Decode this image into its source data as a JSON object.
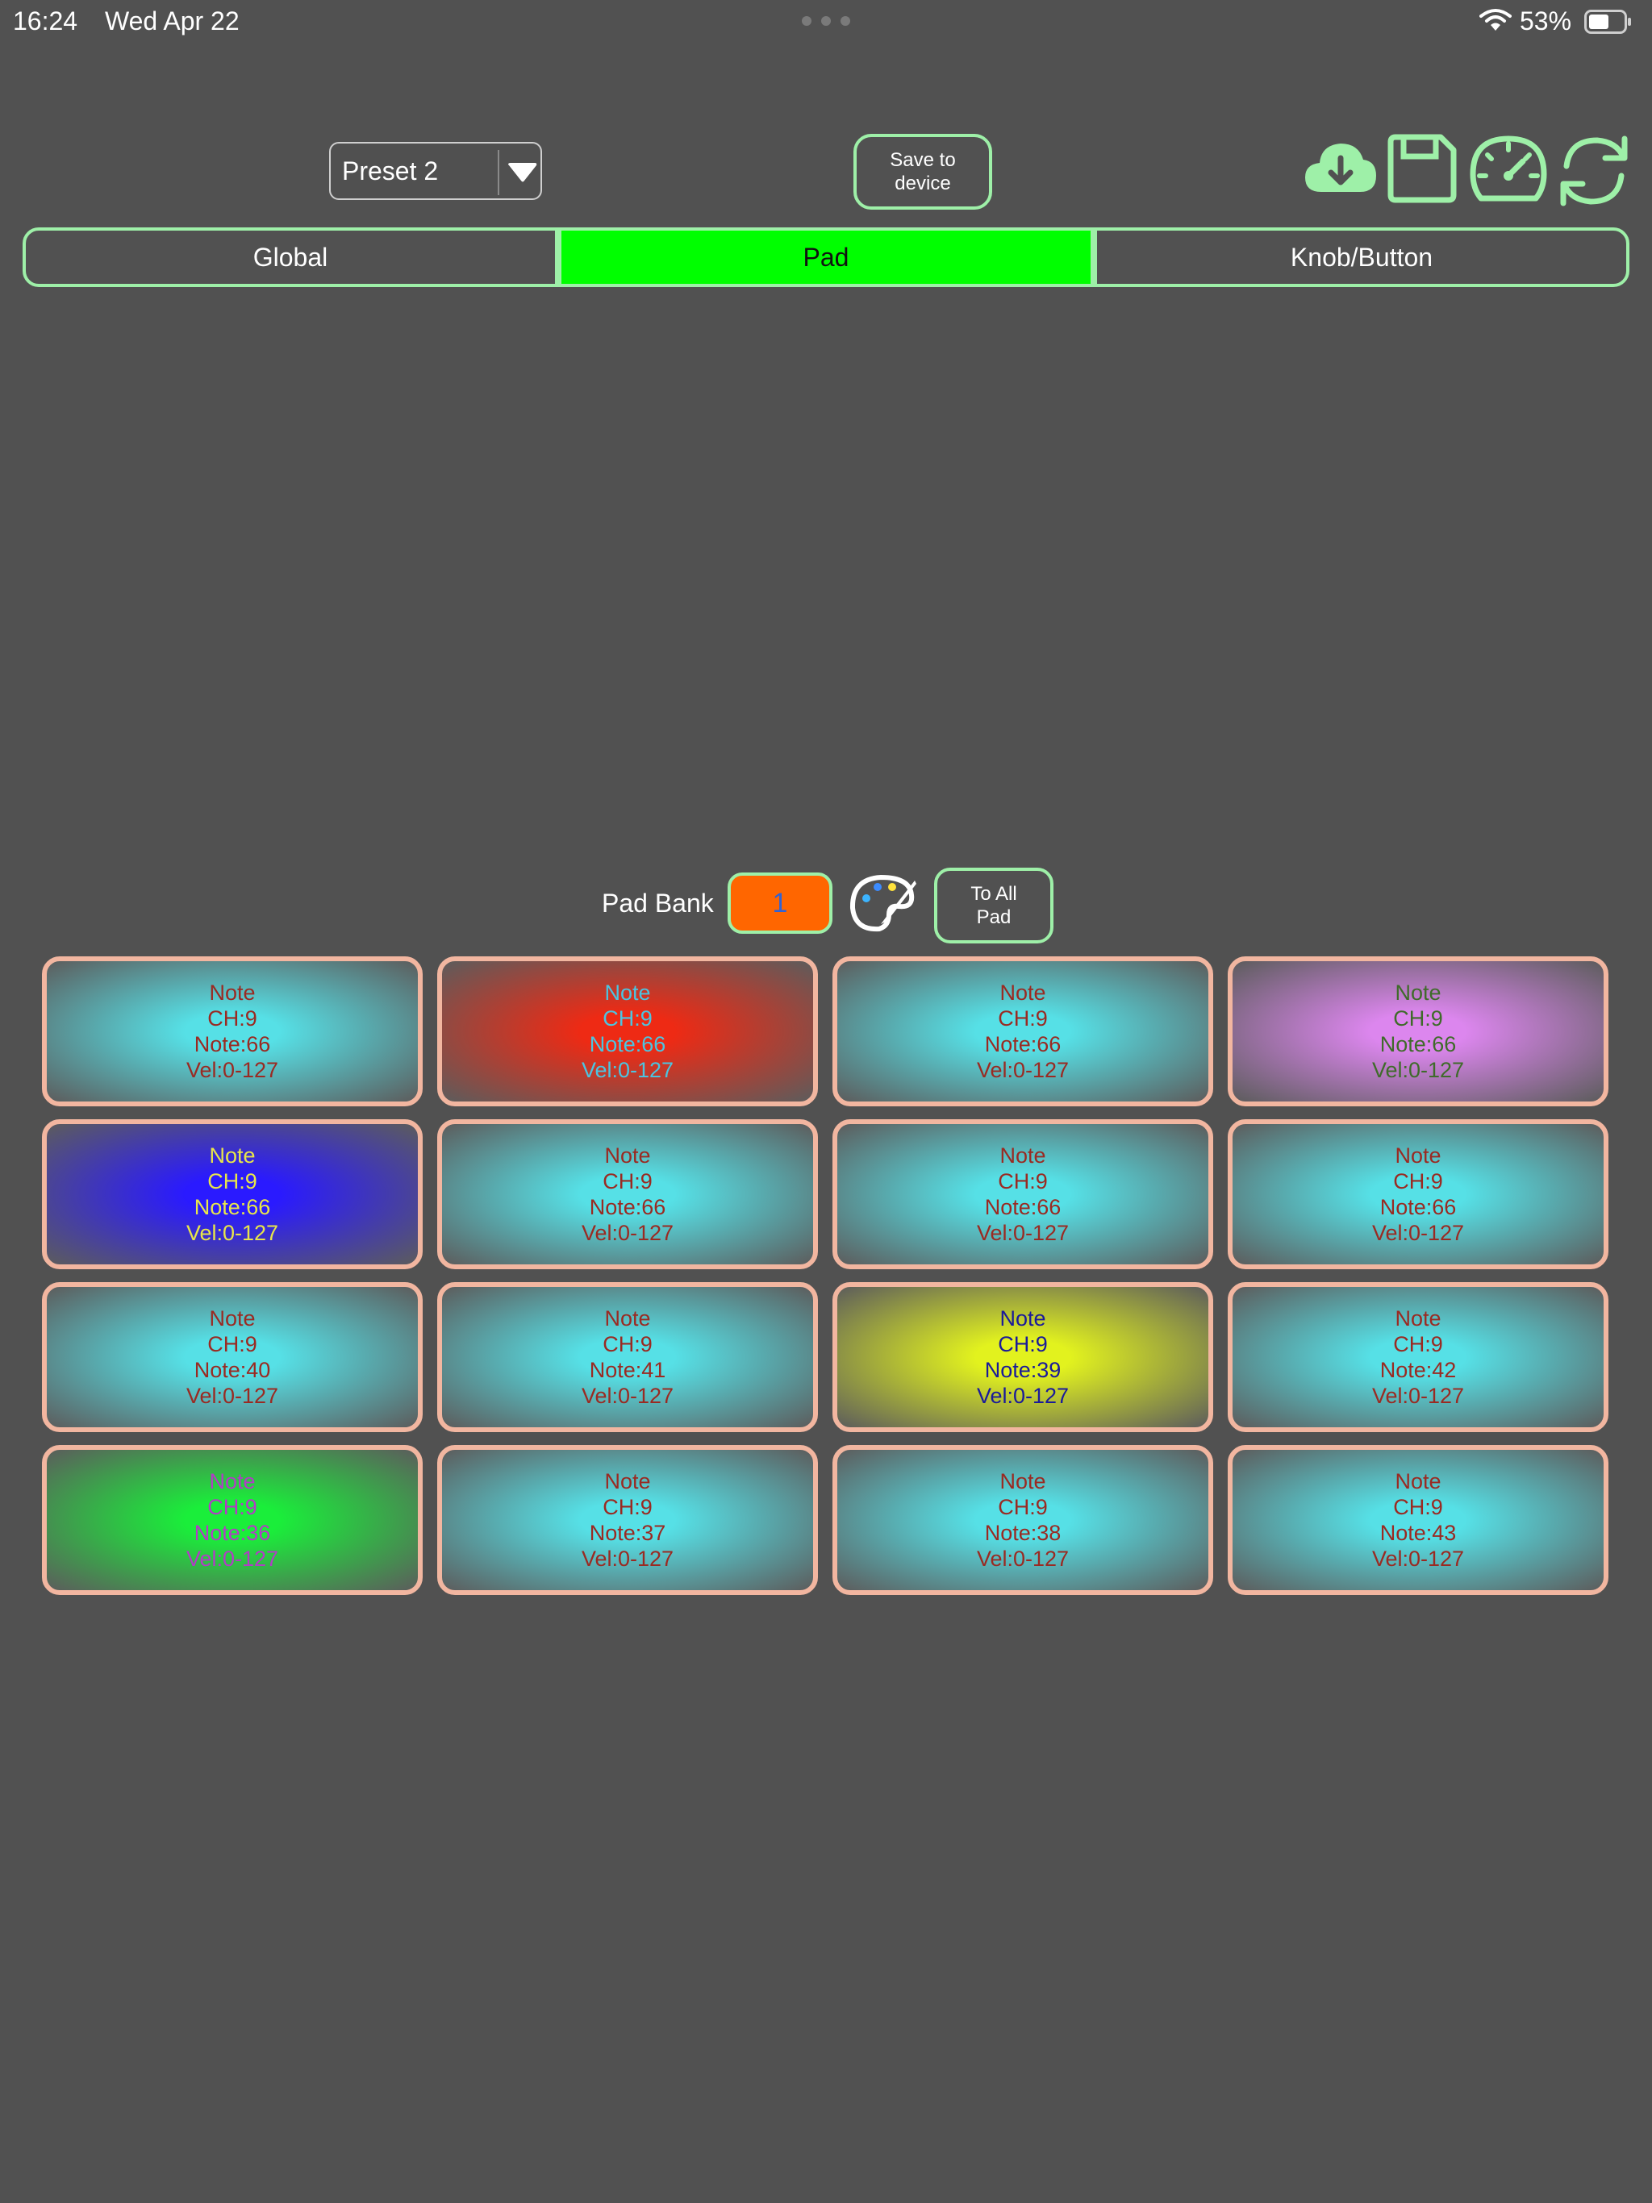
{
  "status": {
    "time": "16:24",
    "date": "Wed Apr 22",
    "battery": "53%"
  },
  "preset": {
    "label": "Preset 2"
  },
  "save_button": "Save to\ndevice",
  "toolbar_icons": [
    "download-cloud-icon",
    "floppy-disk-icon",
    "speedometer-icon",
    "refresh-icon"
  ],
  "tabs": [
    {
      "label": "Global",
      "active": false
    },
    {
      "label": "Pad",
      "active": true
    },
    {
      "label": "Knob/Button",
      "active": false
    }
  ],
  "pad_bank": {
    "label": "Pad Bank",
    "value": "1",
    "to_all": "To All\nPad"
  },
  "pads": [
    {
      "type": "Note",
      "ch": "CH:9",
      "note": "Note:66",
      "vel": "Vel:0-127",
      "color": "#56e0e6",
      "text": "#9a2a22"
    },
    {
      "type": "Note",
      "ch": "CH:9",
      "note": "Note:66",
      "vel": "Vel:0-127",
      "color": "#ee2a14",
      "text": "#4cc4e0"
    },
    {
      "type": "Note",
      "ch": "CH:9",
      "note": "Note:66",
      "vel": "Vel:0-127",
      "color": "#56e0e6",
      "text": "#9a2a22"
    },
    {
      "type": "Note",
      "ch": "CH:9",
      "note": "Note:66",
      "vel": "Vel:0-127",
      "color": "#dc86ee",
      "text": "#3f6b2a"
    },
    {
      "type": "Note",
      "ch": "CH:9",
      "note": "Note:66",
      "vel": "Vel:0-127",
      "color": "#2a1aff",
      "text": "#e8e64a"
    },
    {
      "type": "Note",
      "ch": "CH:9",
      "note": "Note:66",
      "vel": "Vel:0-127",
      "color": "#56e0e6",
      "text": "#9a2a22"
    },
    {
      "type": "Note",
      "ch": "CH:9",
      "note": "Note:66",
      "vel": "Vel:0-127",
      "color": "#56e0e6",
      "text": "#9a2a22"
    },
    {
      "type": "Note",
      "ch": "CH:9",
      "note": "Note:66",
      "vel": "Vel:0-127",
      "color": "#56e0e6",
      "text": "#9a2a22"
    },
    {
      "type": "Note",
      "ch": "CH:9",
      "note": "Note:40",
      "vel": "Vel:0-127",
      "color": "#56e0e6",
      "text": "#9a2a22"
    },
    {
      "type": "Note",
      "ch": "CH:9",
      "note": "Note:41",
      "vel": "Vel:0-127",
      "color": "#56e0e6",
      "text": "#9a2a22"
    },
    {
      "type": "Note",
      "ch": "CH:9",
      "note": "Note:39",
      "vel": "Vel:0-127",
      "color": "#e2f21e",
      "text": "#1a1a9a"
    },
    {
      "type": "Note",
      "ch": "CH:9",
      "note": "Note:42",
      "vel": "Vel:0-127",
      "color": "#56e0e6",
      "text": "#9a2a22"
    },
    {
      "type": "Note",
      "ch": "CH:9",
      "note": "Note:36",
      "vel": "Vel:0-127",
      "color": "#1aee3a",
      "text": "#b23cc6"
    },
    {
      "type": "Note",
      "ch": "CH:9",
      "note": "Note:37",
      "vel": "Vel:0-127",
      "color": "#56e0e6",
      "text": "#9a2a22"
    },
    {
      "type": "Note",
      "ch": "CH:9",
      "note": "Note:38",
      "vel": "Vel:0-127",
      "color": "#56e0e6",
      "text": "#9a2a22"
    },
    {
      "type": "Note",
      "ch": "CH:9",
      "note": "Note:43",
      "vel": "Vel:0-127",
      "color": "#56e0e6",
      "text": "#9a2a22"
    }
  ],
  "accent_color": "#9ef0a8",
  "active_tab_color": "#00ff00",
  "bank_color": "#ff6600"
}
